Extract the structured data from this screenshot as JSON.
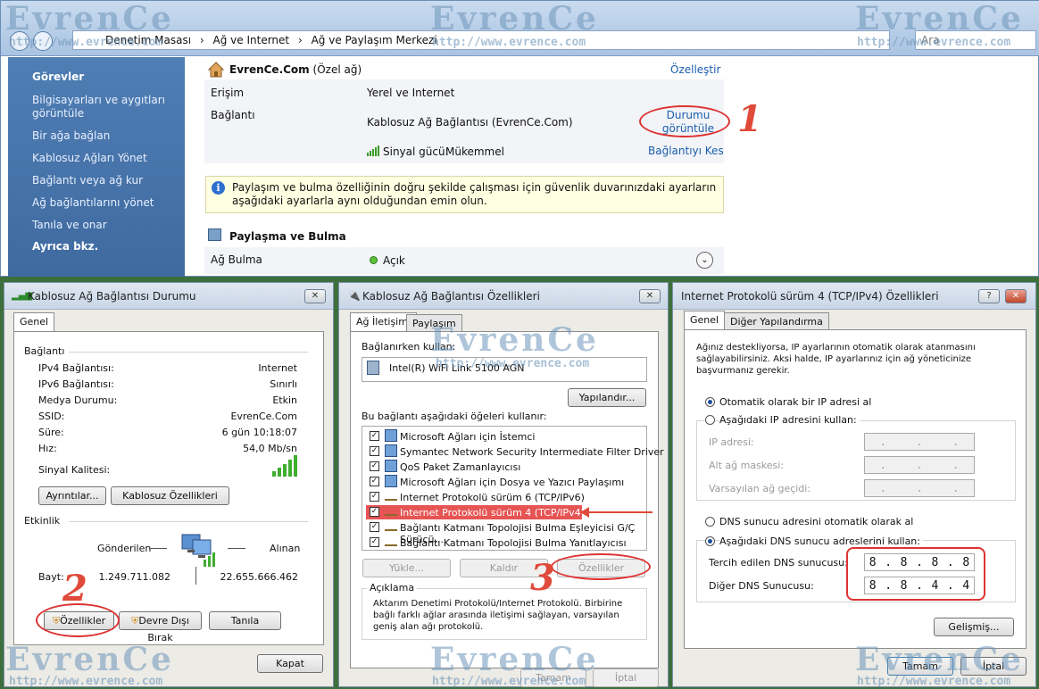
{
  "explorer": {
    "breadcrumb": [
      "Denetim Masası",
      "Ağ ve Internet",
      "Ağ ve Paylaşım Merkezi"
    ],
    "search_placeholder": "Ara",
    "sidebar": {
      "heading": "Görevler",
      "items": [
        "Bilgisayarları ve aygıtları görüntüle",
        "Bir ağa bağlan",
        "Kablosuz Ağları Yönet",
        "Bağlantı veya ağ kur",
        "Ağ bağlantılarını yönet",
        "Tanıla ve onar"
      ],
      "see_also": "Ayrıca bkz."
    },
    "network_name": "EvrenCe.Com",
    "network_type": "(Özel ağ)",
    "customize": "Özelleştir",
    "access_label": "Erişim",
    "access_value": "Yerel ve Internet",
    "connection_label": "Bağlantı",
    "connection_value": "Kablosuz Ağ Bağlantısı (EvrenCe.Com)",
    "view_status": "Durumu görüntüle",
    "signal_label": "Sinyal gücü:",
    "signal_value": "Mükemmel",
    "disconnect": "Bağlantıyı Kes",
    "info_text": "Paylaşım ve bulma özelliğinin doğru şekilde çalışması için güvenlik duvarınızdaki ayarların aşağıdaki ayarlarla aynı olduğundan emin olun.",
    "sharing_heading": "Paylaşma ve Bulma",
    "discovery_label": "Ağ Bulma",
    "discovery_value": "Açık"
  },
  "status_dialog": {
    "title": "Kablosuz Ağ Bağlantısı Durumu",
    "tab": "Genel",
    "connection_group": "Bağlantı",
    "rows": [
      {
        "label": "IPv4 Bağlantısı:",
        "value": "Internet"
      },
      {
        "label": "IPv6 Bağlantısı:",
        "value": "Sınırlı"
      },
      {
        "label": "Medya Durumu:",
        "value": "Etkin"
      },
      {
        "label": "SSID:",
        "value": "EvrenCe.Com"
      },
      {
        "label": "Süre:",
        "value": "6 gün 10:18:07"
      },
      {
        "label": "Hız:",
        "value": "54,0 Mb/sn"
      }
    ],
    "signal_quality": "Sinyal Kalitesi:",
    "details_button": "Ayrıntılar...",
    "wireless_props_button": "Kablosuz Özellikleri",
    "activity_group": "Etkinlik",
    "sent": "Gönderilen",
    "received": "Alınan",
    "bytes_label": "Bayt:",
    "bytes_sent": "1.249.711.082",
    "bytes_received": "22.655.666.462",
    "properties_button": "Özellikler",
    "disable_button": "Devre Dışı Bırak",
    "diagnose_button": "Tanıla",
    "close_button": "Kapat"
  },
  "props_dialog": {
    "title": "Kablosuz Ağ Bağlantısı Özellikleri",
    "tabs": [
      "Ağ İletişimi",
      "Paylaşım"
    ],
    "connect_using": "Bağlanırken kullan:",
    "adapter": "Intel(R) WiFi Link 5100 AGN",
    "configure_button": "Yapılandır...",
    "items_label": "Bu bağlantı aşağıdaki öğeleri kullanır:",
    "items": [
      "Microsoft Ağları için İstemci",
      "Symantec Network Security Intermediate Filter Driver",
      "QoS Paket Zamanlayıcısı",
      "Microsoft Ağları için Dosya ve Yazıcı Paylaşımı",
      "Internet Protokolü sürüm 6 (TCP/IPv6)",
      "Internet Protokolü sürüm 4 (TCP/IPv4)",
      "Bağlantı Katmanı Topolojisi Bulma Eşleyicisi G/Ç Sürücü...",
      "Bağlantı Katmanı Topolojisi Bulma Yanıtlayıcısı"
    ],
    "install_button": "Yükle...",
    "uninstall_button": "Kaldır",
    "properties_button": "Özellikler",
    "description_group": "Açıklama",
    "description": "Aktarım Denetimi Protokolü/Internet Protokolü. Birbirine bağlı farklı ağlar arasında iletişimi sağlayan, varsayılan geniş alan ağı protokolü.",
    "ok_button": "Tamam",
    "cancel_button": "İptal"
  },
  "ipv4_dialog": {
    "title": "Internet Protokolü sürüm 4 (TCP/IPv4) Özellikleri",
    "help_button": "?",
    "tabs": [
      "Genel",
      "Diğer Yapılandırma"
    ],
    "intro": "Ağınız destekliyorsa, IP ayarlarının otomatik olarak atanmasını sağlayabilirsiniz. Aksi halde, IP ayarlarınız için ağ yöneticinize başvurmanız gerekir.",
    "auto_ip": "Otomatik olarak bir IP adresi al",
    "manual_ip": "Aşağıdaki IP adresini kullan:",
    "ip_address": "IP adresi:",
    "subnet": "Alt ağ maskesi:",
    "gateway": "Varsayılan ağ geçidi:",
    "auto_dns": "DNS sunucu adresini otomatik olarak al",
    "manual_dns": "Aşağıdaki DNS sunucu adreslerini kullan:",
    "preferred_dns": "Tercih edilen DNS sunucusu:",
    "alternate_dns": "Diğer DNS Sunucusu:",
    "preferred_octets": [
      "8",
      "8",
      "8",
      "8"
    ],
    "alternate_octets": [
      "8",
      "8",
      "4",
      "4"
    ],
    "advanced_button": "Gelişmiş...",
    "ok_button": "Tamam",
    "cancel_button": "İptal"
  },
  "annotations": {
    "step1": "1",
    "step2": "2",
    "step3": "3"
  },
  "watermark": {
    "brand": "EvrenCe",
    "url": "http://www.evrence.com"
  }
}
